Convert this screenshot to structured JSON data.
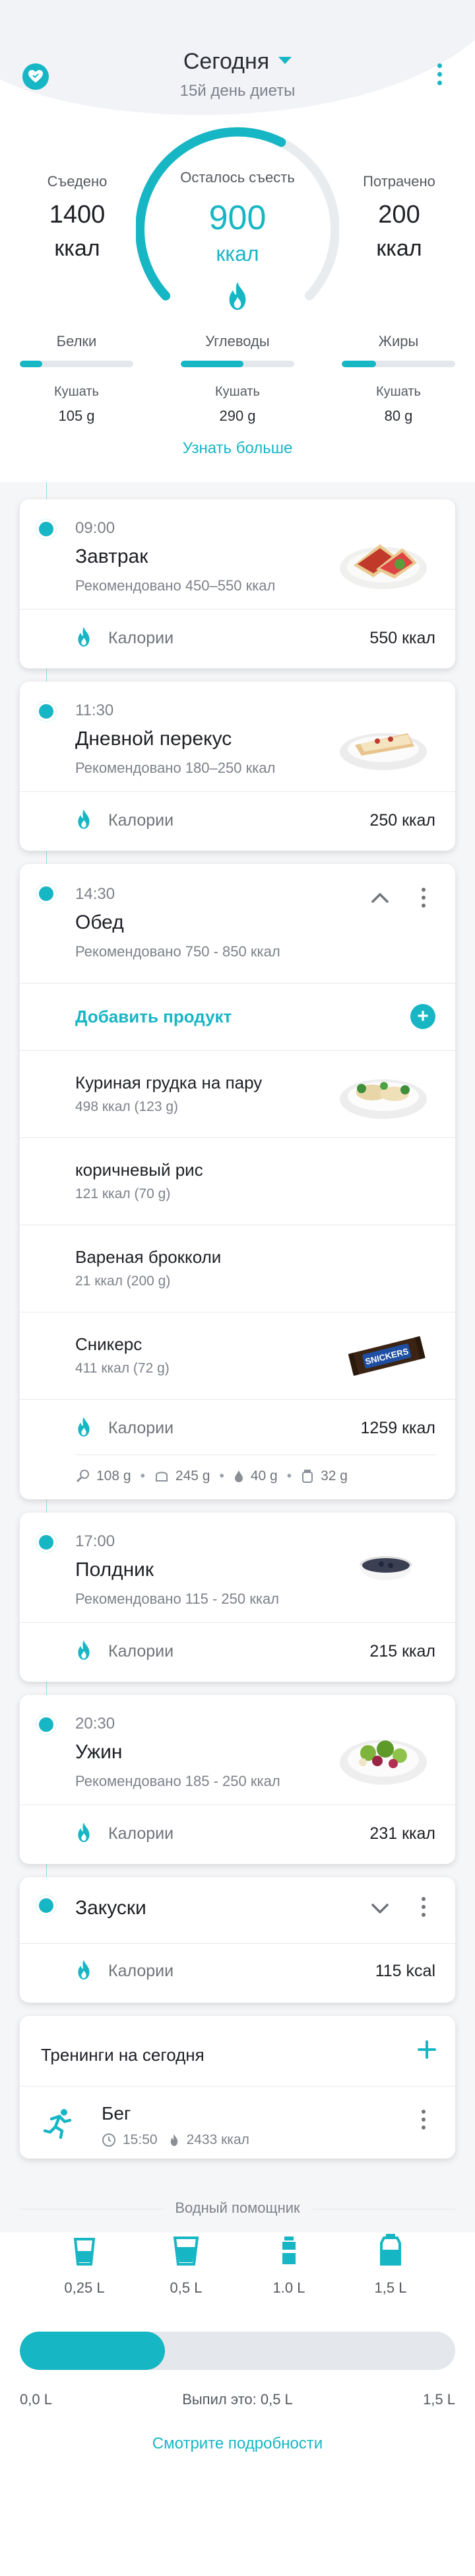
{
  "header": {
    "title": "Сегодня",
    "subtitle": "15й день диеты"
  },
  "summary": {
    "eaten": {
      "label": "Съедено",
      "value": "1400",
      "unit": "ккал"
    },
    "remaining": {
      "label": "Осталось съесть",
      "value": "900",
      "unit": "ккал"
    },
    "burned": {
      "label": "Потрачено",
      "value": "200",
      "unit": "ккал"
    },
    "ring_progress_fraction": 0.6
  },
  "macros": [
    {
      "label": "Белки",
      "sub": "Кушать",
      "grams": "105 g",
      "progress_fraction": 0.2
    },
    {
      "label": "Углеводы",
      "sub": "Кушать",
      "grams": "290 g",
      "progress_fraction": 0.55
    },
    {
      "label": "Жиры",
      "sub": "Кушать",
      "grams": "80 g",
      "progress_fraction": 0.3
    }
  ],
  "learn_more": "Узнать больше",
  "calories_label": "Калории",
  "meals": {
    "breakfast": {
      "time": "09:00",
      "name": "Завтрак",
      "rec": "Рекомендовано 450–550 ккал",
      "cal": "550 ккал"
    },
    "snack1": {
      "time": "11:30",
      "name": "Дневной перекус",
      "rec": "Рекомендовано 180–250 ккал",
      "cal": "250 ккал"
    },
    "lunch": {
      "time": "14:30",
      "name": "Обед",
      "rec": "Рекомендовано 750 - 850 ккал",
      "add_label": "Добавить продукт",
      "items": [
        {
          "name": "Куриная грудка на пару",
          "desc": "498 ккал (123 g)"
        },
        {
          "name": "коричневый рис",
          "desc": "121 ккал  (70 g)"
        },
        {
          "name": "Вареная брокколи",
          "desc": "21 ккал (200 g)"
        },
        {
          "name": "Сникерс",
          "desc": "411 ккал (72 g)"
        }
      ],
      "cal": "1259 ккал",
      "nutrients": {
        "a": "108 g",
        "b": "245 g",
        "c": "40 g",
        "d": "32 g"
      },
      "snickers_text": "SNICKERS"
    },
    "snack2": {
      "time": "17:00",
      "name": "Полдник",
      "rec": "Рекомендовано 115 - 250 ккал",
      "cal": "215 ккал"
    },
    "dinner": {
      "time": "20:30",
      "name": "Ужин",
      "rec": "Рекомендовано 185 - 250 ккал",
      "cal": "231 ккал"
    },
    "snacks": {
      "name": "Закуски",
      "cal": "115 kcal"
    }
  },
  "training": {
    "title": "Тренинги на сегодня",
    "item": {
      "name": "Бег",
      "time": "15:50",
      "cal": "2433 ккал"
    }
  },
  "water": {
    "title": "Водный помощник",
    "options": [
      "0,25 L",
      "0,5 L",
      "1.0 L",
      "1,5 L"
    ],
    "min": "0,0 L",
    "status": "Выпил это: 0,5 L",
    "max": "1,5 L",
    "progress_fraction": 0.333,
    "details": "Смотрите подробности"
  },
  "colors": {
    "accent": "#17b6c4",
    "track": "#e4e7eb"
  }
}
